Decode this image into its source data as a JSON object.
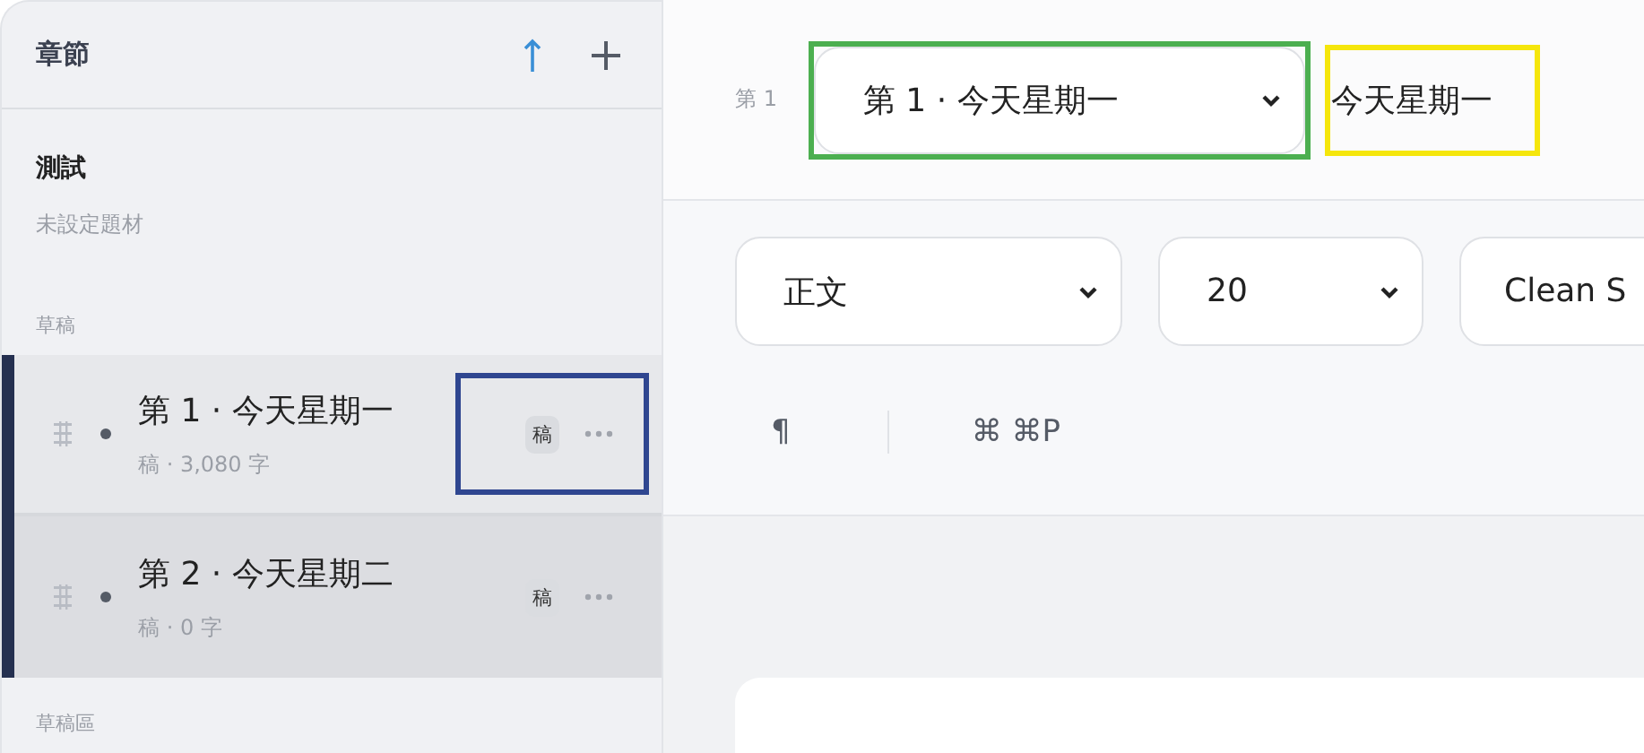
{
  "sidebar": {
    "title": "章節",
    "project": {
      "name": "測試",
      "genre": "未設定題材"
    },
    "sections": [
      {
        "label": "草稿",
        "chapters": [
          {
            "title": "第 1 · 今天星期一",
            "meta": "稿 · 3,080 字",
            "badge": "稿",
            "selected": true
          },
          {
            "title": "第 2 · 今天星期二",
            "meta": "稿 · 0 字",
            "badge": "稿",
            "selected": false
          }
        ]
      },
      {
        "label": "草稿區"
      }
    ]
  },
  "editor": {
    "chapter_label": "第 1",
    "chapter_select": "第 1 · 今天星期一",
    "title": "今天星期一",
    "toolbar": {
      "style": "正文",
      "size": "20",
      "font": "Clean S",
      "pilcrow": "¶",
      "shortcut": "⌘ ⌘P"
    }
  }
}
